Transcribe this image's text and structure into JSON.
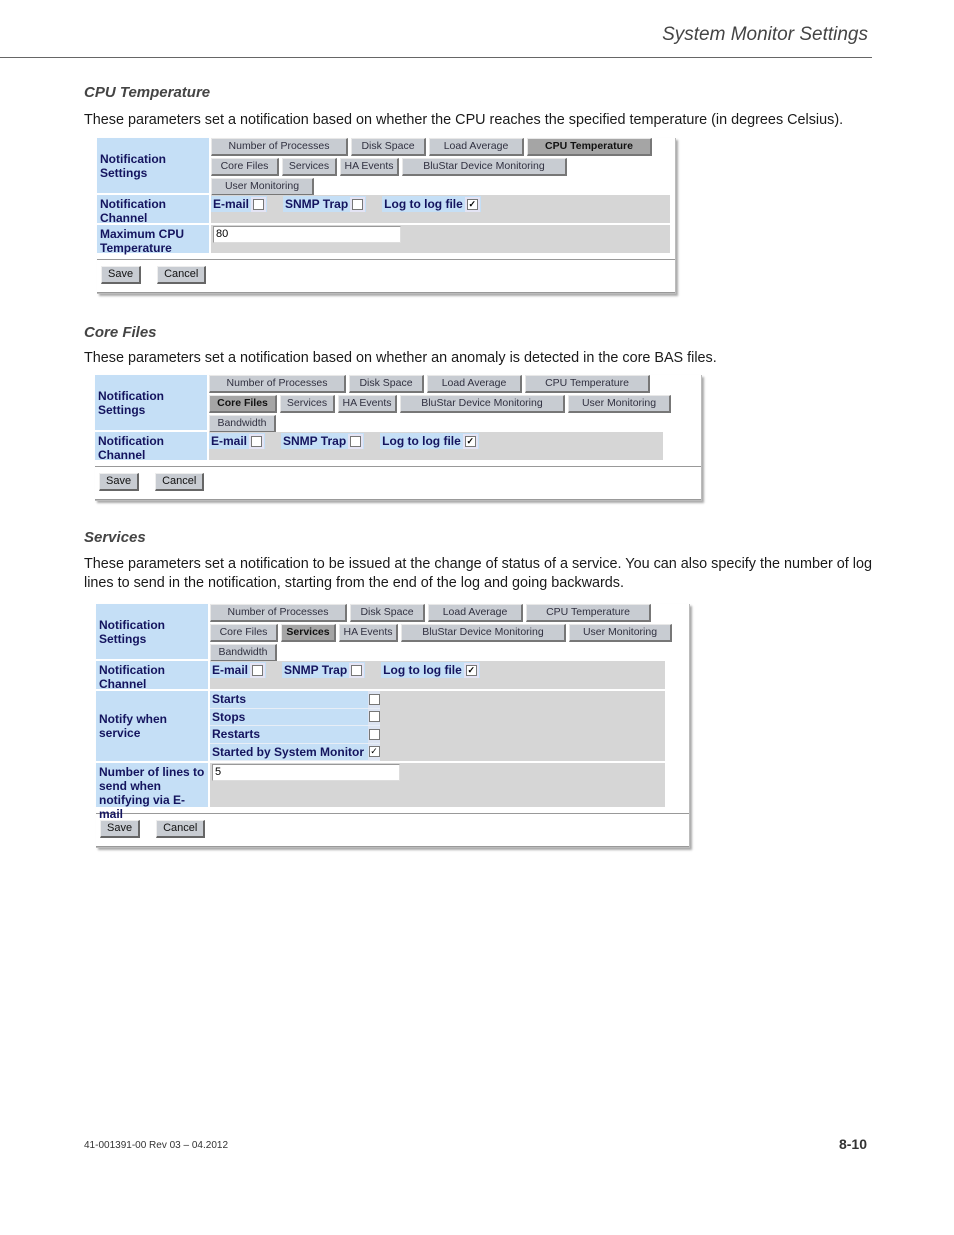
{
  "header": {
    "running_title": "System Monitor Settings"
  },
  "tabs": [
    "Number of Processes",
    "Disk Space",
    "Load Average",
    "CPU Temperature",
    "Core Files",
    "Services",
    "HA Events",
    "BluStar Device Monitoring",
    "User Monitoring",
    "Bandwidth"
  ],
  "labels": {
    "notification_settings": "Notification Settings",
    "notification_channel": "Notification Channel",
    "email": "E-mail",
    "snmp_trap": "SNMP Trap",
    "log_to_file": "Log to log file",
    "save": "Save",
    "cancel": "Cancel"
  },
  "sections": [
    {
      "title": "CPU Temperature",
      "description": "These parameters set a notification based on whether the CPU reaches the specified temperature (in degrees Celsius).",
      "active_tab": "CPU Temperature",
      "channel": {
        "email": false,
        "snmp_trap": false,
        "log_to_file": true
      },
      "max_cpu_label": "Maximum CPU Temperature",
      "max_cpu_value": "80"
    },
    {
      "title": "Core Files",
      "description": "These parameters set a notification based on whether an anomaly is detected in the core BAS files.",
      "active_tab": "Core Files",
      "channel": {
        "email": false,
        "snmp_trap": false,
        "log_to_file": true
      }
    },
    {
      "title": "Services",
      "description": "These parameters set a notification to be issued at the change of status of a service. You can also specify the number of log lines to send in the notification, starting from the end of the log and going backwards.",
      "active_tab": "Services",
      "channel": {
        "email": false,
        "snmp_trap": false,
        "log_to_file": true
      },
      "notify_label": "Notify when service",
      "notify_options": [
        {
          "label": "Starts",
          "checked": false
        },
        {
          "label": "Stops",
          "checked": false
        },
        {
          "label": "Restarts",
          "checked": false
        },
        {
          "label": "Started by System Monitor",
          "checked": true
        }
      ],
      "lines_label": "Number of lines to send when notifying via E-mail",
      "lines_value": "5"
    }
  ],
  "footer": {
    "doc_id": "41-001391-00 Rev 03 – 04.2012",
    "page_number": "8-10"
  }
}
